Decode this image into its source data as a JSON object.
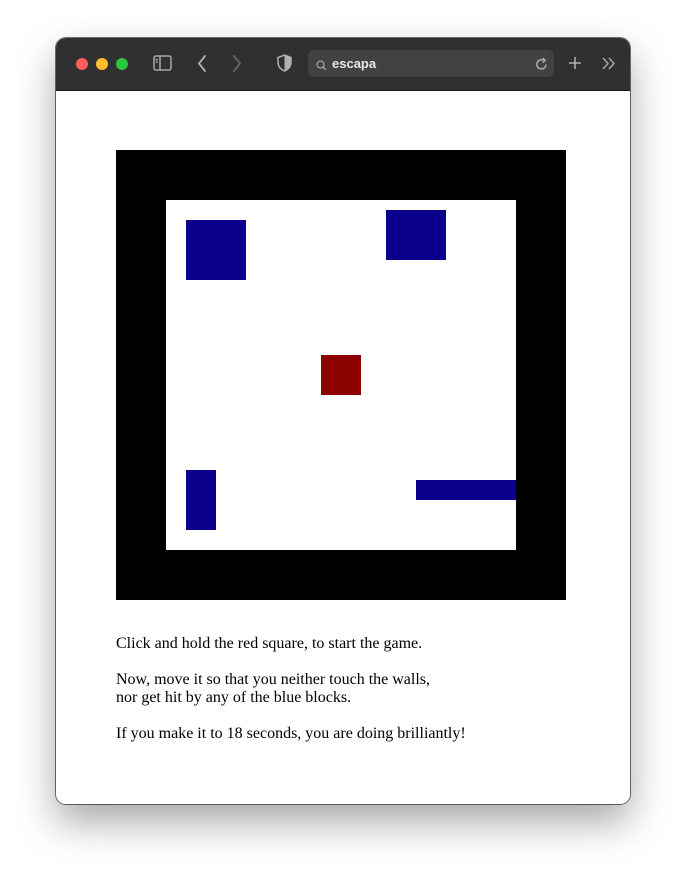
{
  "browser": {
    "url": "escapa"
  },
  "game": {
    "colors": {
      "wall": "#000000",
      "play_area": "#ffffff",
      "player": "#8b0000",
      "enemy": "#0a008b"
    },
    "player_label": "red square",
    "enemies": [
      "blue-block-1",
      "blue-block-2",
      "blue-block-3",
      "blue-block-4"
    ]
  },
  "instructions": {
    "line1": "Click and hold the red square, to start the game.",
    "line2a": "Now, move it so that you neither touch the walls,",
    "line2b": "nor get hit by any of the blue blocks.",
    "line3": "If you make it to 18 seconds, you are doing brilliantly!"
  }
}
